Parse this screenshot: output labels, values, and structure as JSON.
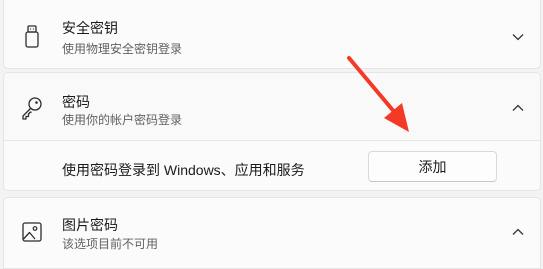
{
  "security_key": {
    "title": "安全密钥",
    "subtitle": "使用物理安全密钥登录",
    "icon": "usb-key-icon",
    "expanded": false
  },
  "password": {
    "title": "密码",
    "subtitle": "使用你的帐户密码登录",
    "icon": "key-icon",
    "expanded": true,
    "setting_label": "使用密码登录到 Windows、应用和服务",
    "add_button_label": "添加"
  },
  "picture_password": {
    "title": "图片密码",
    "subtitle": "该选项目前不可用",
    "icon": "picture-icon",
    "expanded": true
  },
  "annotation": {
    "arrow_color": "#f33a26",
    "points_to": "add-button"
  }
}
